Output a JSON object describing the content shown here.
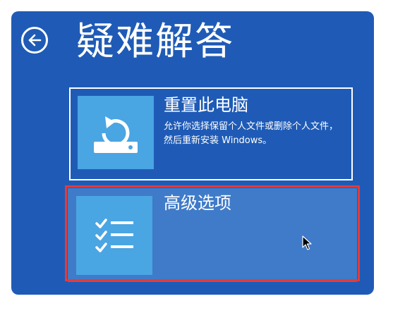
{
  "window": {
    "background": "#1f5bb6",
    "title": "疑难解答"
  },
  "back_button": {
    "icon": "arrow-left-icon"
  },
  "options": [
    {
      "id": "reset-pc",
      "label": "重置此电脑",
      "description": "允许你选择保留个人文件或删除个人文件，然后重新安装 Windows。",
      "icon": "reset-pc-icon",
      "selected": false
    },
    {
      "id": "advanced-options",
      "label": "高级选项",
      "description": "",
      "icon": "checklist-icon",
      "selected": true
    }
  ],
  "colors": {
    "accent_tile": "#4aa5e3",
    "selected_bg": "#3f7bc9",
    "highlight_outline": "#e23b3b"
  }
}
